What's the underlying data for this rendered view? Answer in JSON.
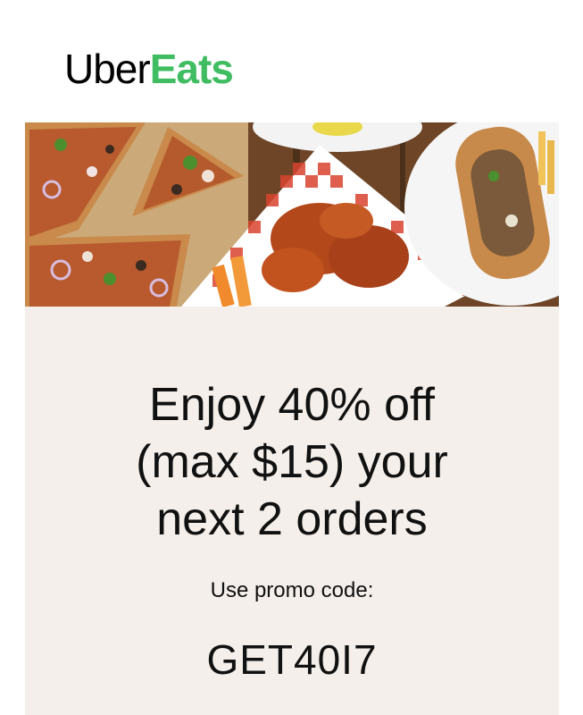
{
  "brand": {
    "logo_part1": "Uber",
    "logo_part2": "Eats",
    "accent_color": "#3fbd60"
  },
  "hero": {
    "image_subject": "food-photo"
  },
  "promo": {
    "headline_line1": "Enjoy 40% off",
    "headline_line2": "(max $15) your",
    "headline_line3": "next 2 orders",
    "label": "Use promo code:",
    "code": "GET40I7",
    "panel_color": "#f4efea"
  }
}
